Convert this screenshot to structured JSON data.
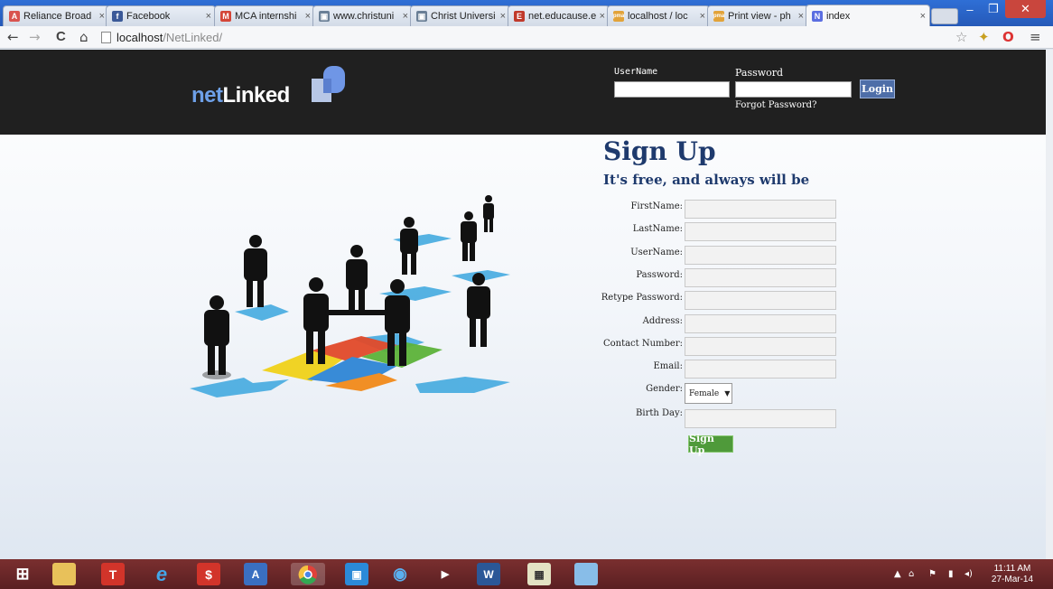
{
  "browser": {
    "tabs": [
      {
        "title": "Reliance Broad",
        "fav": "A",
        "color": "#d9534f"
      },
      {
        "title": "Facebook",
        "fav": "f",
        "color": "#3b5998"
      },
      {
        "title": "MCA internshi",
        "fav": "M",
        "color": "#d44638"
      },
      {
        "title": "www.christuni",
        "fav": "▣",
        "color": "#6a7f96"
      },
      {
        "title": "Christ Universi",
        "fav": "▣",
        "color": "#6a7f96"
      },
      {
        "title": "net.educause.e",
        "fav": "E",
        "color": "#c0392b"
      },
      {
        "title": "localhost / loc",
        "fav": "pma",
        "color": "#e2a33a"
      },
      {
        "title": "Print view - ph",
        "fav": "pma",
        "color": "#e2a33a"
      },
      {
        "title": "index",
        "fav": "N",
        "color": "#5b6ee1"
      }
    ],
    "address": {
      "host": "localhost",
      "path": "/NetLinked/"
    },
    "nav": {
      "back": "←",
      "forward": "→",
      "reload": "C",
      "home": "⌂"
    }
  },
  "header": {
    "logo_prefix": "net",
    "logo_suffix": "Linked",
    "username_label": "UserName",
    "password_label": "Password",
    "login_button": "Login",
    "forgot_password": "Forgot Password?"
  },
  "signup": {
    "title": "Sign Up",
    "subtitle": "It's free, and always will be",
    "fields": [
      {
        "label": "FirstName:"
      },
      {
        "label": "LastName:"
      },
      {
        "label": "UserName:"
      },
      {
        "label": "Password:"
      },
      {
        "label": "Retype Password:"
      },
      {
        "label": "Address:"
      },
      {
        "label": "Contact Number:"
      },
      {
        "label": "Email:"
      }
    ],
    "gender_label": "Gender:",
    "gender_value": "Female",
    "birthday_label": "Birth Day:",
    "submit": "Sign Up"
  },
  "taskbar": {
    "time": "11:11 AM",
    "date": "27-Mar-14"
  }
}
